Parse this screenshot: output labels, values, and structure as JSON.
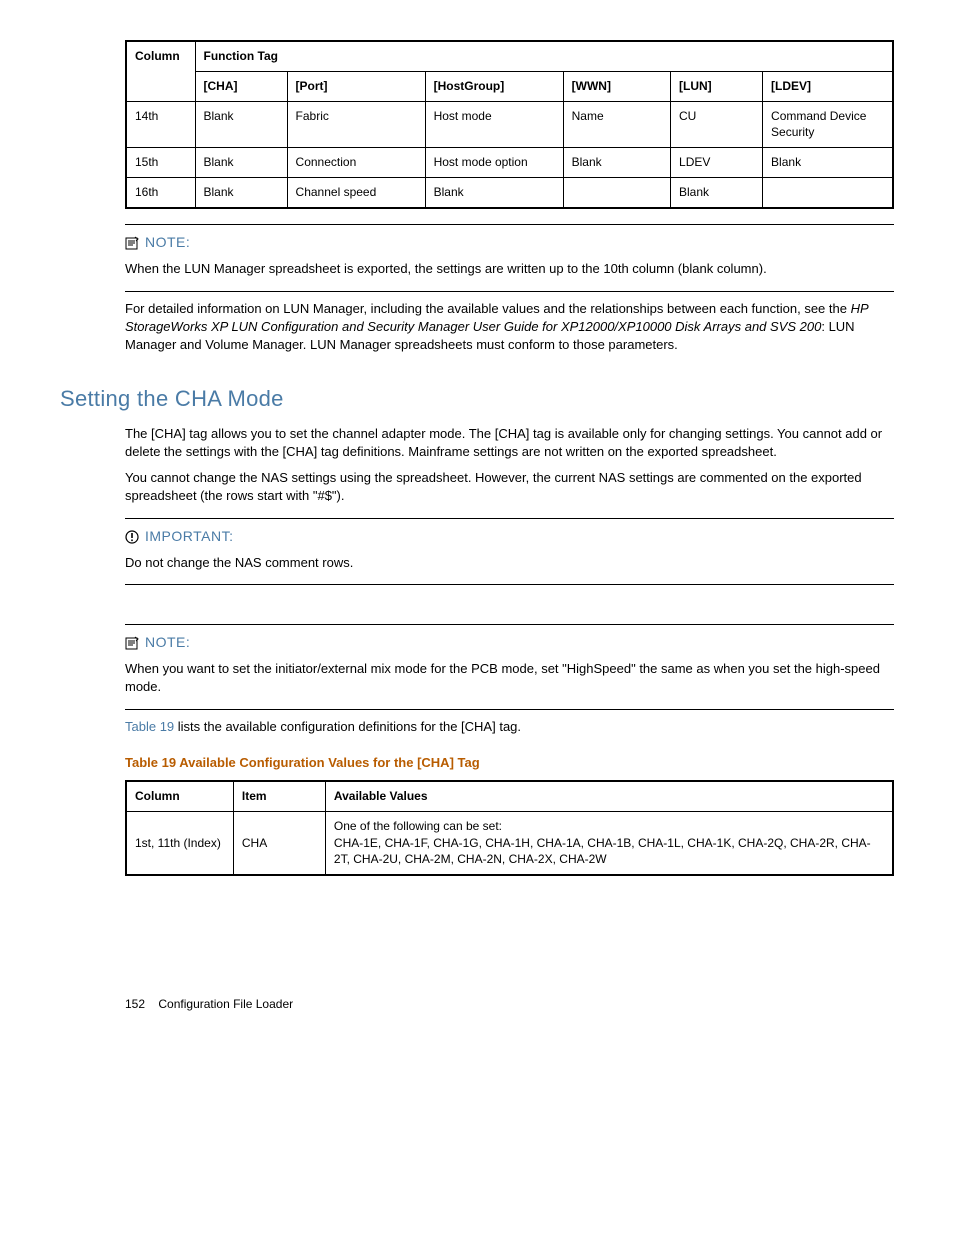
{
  "table1": {
    "header1": "Column",
    "header2": "Function Tag",
    "cols": [
      "[CHA]",
      "[Port]",
      "[HostGroup]",
      "[WWN]",
      "[LUN]",
      "[LDEV]"
    ],
    "rows": [
      {
        "c": "14th",
        "v": [
          "Blank",
          "Fabric",
          "Host mode",
          "Name",
          "CU",
          "Command Device Security"
        ]
      },
      {
        "c": "15th",
        "v": [
          "Blank",
          "Connection",
          "Host mode op­tion",
          "Blank",
          "LDEV",
          "Blank"
        ]
      },
      {
        "c": "16th",
        "v": [
          "Blank",
          "Channel speed",
          "Blank",
          "",
          "Blank",
          ""
        ]
      }
    ]
  },
  "note1": {
    "label": "NOTE:",
    "text": "When the LUN Manager spreadsheet is exported, the settings are written up to the 10th column (blank column)."
  },
  "para1a": "For detailed information on LUN Manager, including the available values and the relationships between each function, see the ",
  "para1b": "HP StorageWorks XP LUN Configuration and Security Manager User Guide for XP12000/XP10000 Disk Arrays and SVS 200",
  "para1c": ": LUN Manager and Volume Manager. LUN Manager spreadsheets must conform to those parameters.",
  "heading": "Setting the CHA Mode",
  "para2": "The [CHA] tag allows you to set the channel adapter mode. The [CHA] tag is available only for changing settings. You cannot add or delete the settings with the [CHA] tag definitions. Mainframe settings are not written on the exported spreadsheet.",
  "para3": "You cannot change the NAS settings using the spreadsheet. However, the current NAS settings are commented on the exported spreadsheet (the rows start with \"#$\").",
  "important": {
    "label": "IMPORTANT:",
    "text": "Do not change the NAS comment rows."
  },
  "note2": {
    "label": "NOTE:",
    "text": "When you want to set the initiator/external mix mode for the PCB mode, set \"HighSpeed\" the same as when you set the high-speed mode."
  },
  "para4a": "Table 19",
  "para4b": " lists the available configuration definitions for the [CHA] tag.",
  "table2caption": "Table 19 Available Configuration Values for the [CHA] Tag",
  "table2": {
    "headers": [
      "Column",
      "Item",
      "Available Values"
    ],
    "row": {
      "c1": "1st, 11th (In­dex)",
      "c2": "CHA",
      "c3a": "One of the following can be set:",
      "c3b": "CHA-1E, CHA-1F, CHA-1G, CHA-1H, CHA-1A, CHA-1B, CHA-1L, CHA-1K, CHA-2Q, CHA-2R, CHA-2T, CHA-2U, CHA-2M, CHA-2N, CHA-2X, CHA-2W"
    }
  },
  "footer": {
    "page": "152",
    "title": "Configuration File Loader"
  }
}
